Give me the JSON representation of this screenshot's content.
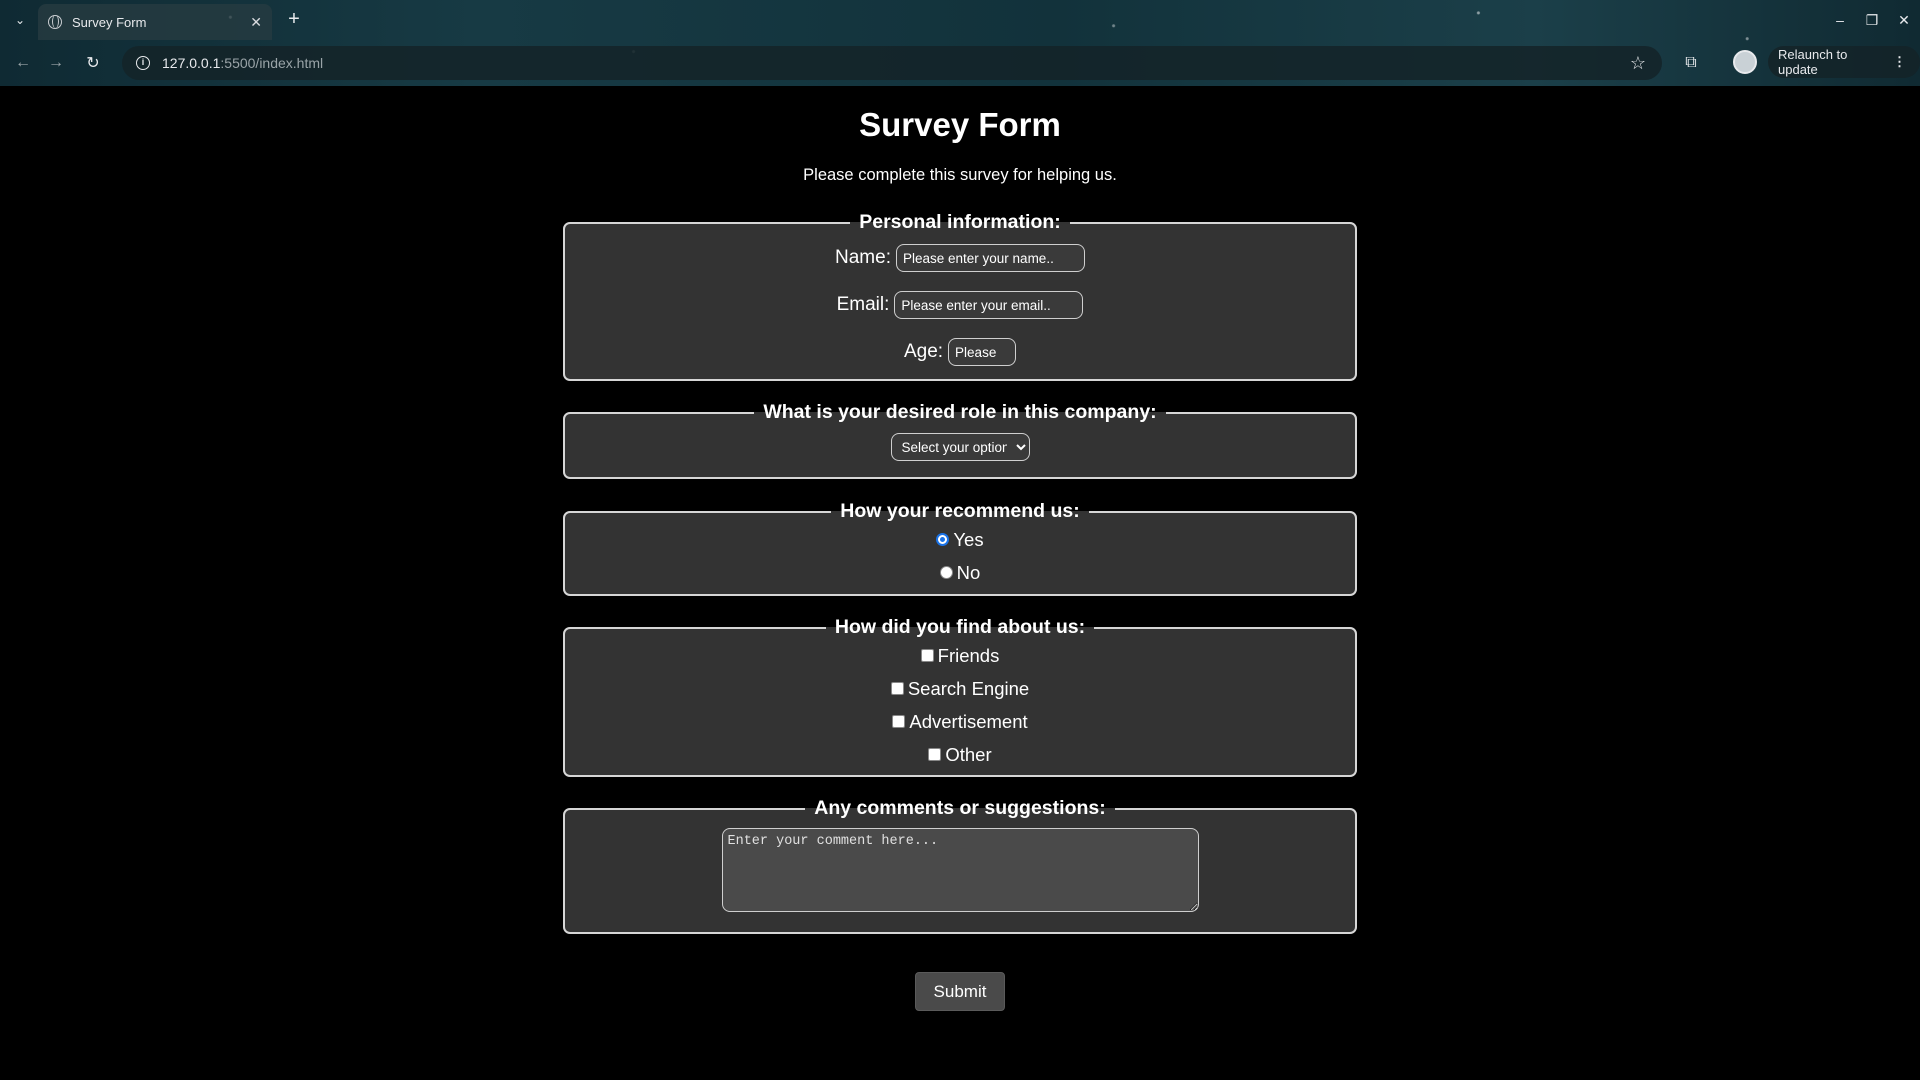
{
  "browser": {
    "tab_title": "Survey Form",
    "tab_close": "✕",
    "new_tab": "+",
    "url_host": "127.0.0.1",
    "url_path": ":5500/index.html",
    "relaunch_label": "Relaunch to update",
    "window_controls": {
      "minimize": "–",
      "restore": "❐",
      "close": "✕"
    }
  },
  "page": {
    "title": "Survey Form",
    "description": "Please complete this survey for helping us."
  },
  "personal": {
    "legend": "Personal information:",
    "name_label": "Name:",
    "name_placeholder": "Please enter your name..",
    "email_label": "Email:",
    "email_placeholder": "Please enter your email..",
    "age_label": "Age:",
    "age_placeholder": "Please"
  },
  "role": {
    "legend": "What is your desired role in this company:",
    "selected": "Select your option"
  },
  "recommend": {
    "legend": "How your recommend us:",
    "options": [
      {
        "label": "Yes",
        "checked": true
      },
      {
        "label": "No",
        "checked": false
      }
    ]
  },
  "find": {
    "legend": "How did you find about us:",
    "options": [
      "Friends",
      "Search Engine",
      "Advertisement",
      "Other"
    ]
  },
  "comments": {
    "legend": "Any comments or suggestions:",
    "placeholder": "Enter your comment here..."
  },
  "submit_label": "Submit",
  "colors": {
    "page_bg": "#000000",
    "fieldset_bg": "#333333",
    "radio_accent": "#1a73e8"
  }
}
